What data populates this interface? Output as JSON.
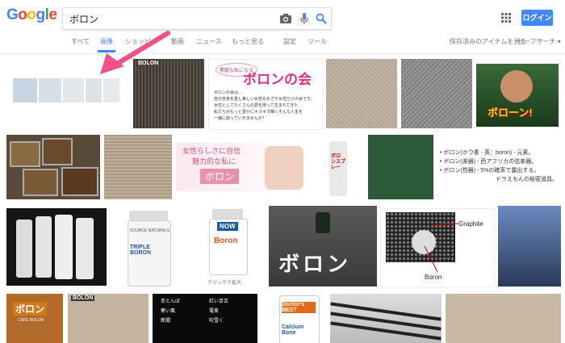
{
  "header": {
    "logo": [
      "G",
      "o",
      "o",
      "g",
      "l",
      "e"
    ],
    "logo_colors": [
      "#4285f4",
      "#ea4335",
      "#fbbc05",
      "#4285f4",
      "#34a853",
      "#ea4335"
    ],
    "query": "ボロン",
    "login_label": "ログイン"
  },
  "tabs": {
    "items": [
      "すべて",
      "画像",
      "ショッピ",
      "動画",
      "ニュース",
      "もっと見る",
      "設定",
      "ツール"
    ],
    "active": "画像",
    "right": [
      "保存済みのアイテムを見る",
      "セーフサーチ ▾"
    ]
  },
  "thumbs": {
    "bolon_sign": "BOLON",
    "bolon_sign2": "BOLON",
    "boron_kai_title": "ボロンの会",
    "boron_kai_tagline": "素敵な私になる",
    "boron_kai_body": [
      "ボロンの会は…",
      "自分自身を愛し美しい女性をめざす女性だけの会です。",
      "女性としてたくさんの愛を持って生まれてきた",
      "私たちがもっと豊かにキラキラ輝くそんな人生を",
      "一緒に創っていきませんか？"
    ],
    "wrestler_caption": "ボローン!",
    "boron_ad_title": "女性らしさに自信",
    "boron_ad_sub": "魅力的な私に",
    "boron_ad_word": "ボロン",
    "spray_label": "ボロンスプレー",
    "text_list": [
      "• ボロン(ホウ素 - 英：boron) - 元素。",
      "• ボロン(楽器) - 西アフリカの弦楽器。",
      "• ボロン(性器) - 5%の確率で露出する。",
      "ドラえもんの秘密道具。"
    ],
    "triple_boron": "TRIPLE BORON",
    "source_naturals": "SOURCE NATURALS",
    "now_boron": "Boron",
    "now_brand": "NOW",
    "enlarge_caption": "クリックで拡大",
    "pill_word": "ボロン",
    "graphite": "Graphite",
    "boron_label": "Boron",
    "cafe_sign": "ボロン",
    "cafe_sub": "CAFE BOLON",
    "doctors_best": "Doctor's BEST",
    "calcium": "Calcium Bone",
    "manga_text": [
      "赤とんぼ",
      "紅い百舌",
      "寒い風",
      "電車",
      "新聞",
      "吹雪く"
    ]
  }
}
